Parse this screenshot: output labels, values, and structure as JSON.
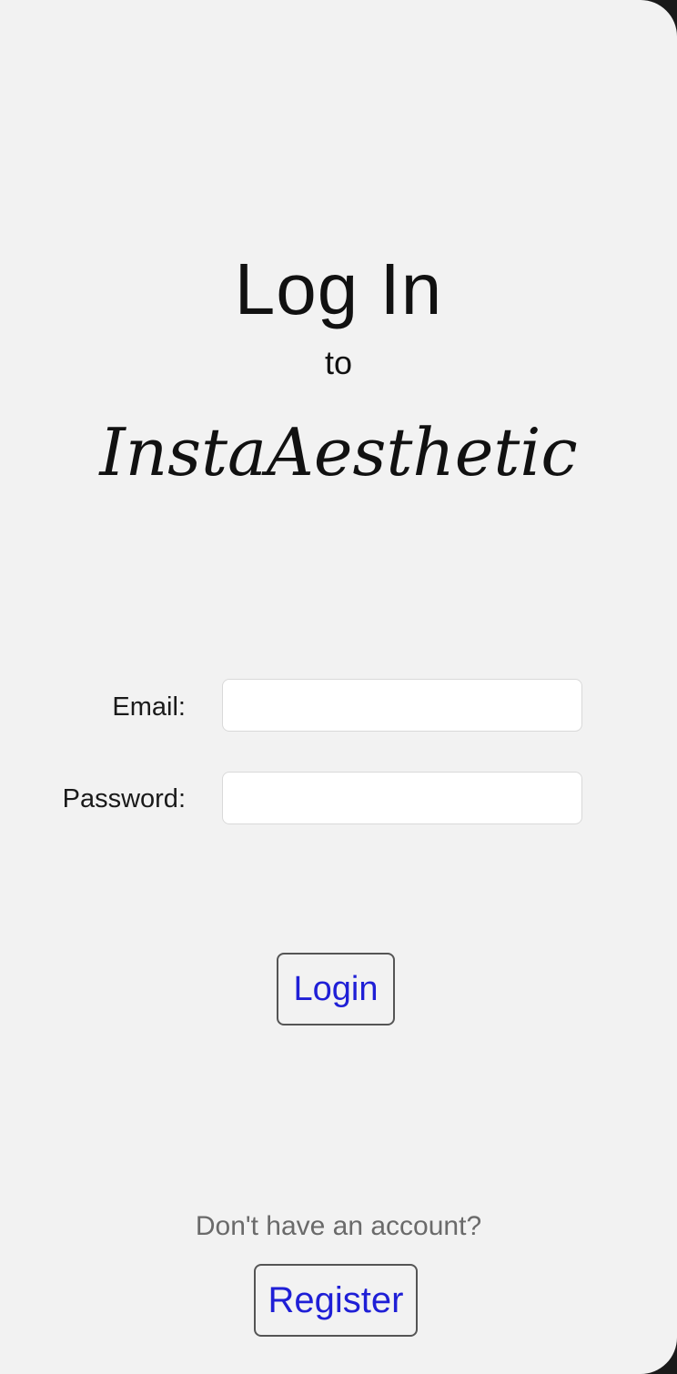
{
  "header": {
    "title": "Log In",
    "connector": "to",
    "app_name": "InstaAesthetic"
  },
  "form": {
    "email_label": "Email:",
    "email_value": "",
    "password_label": "Password:",
    "password_value": "",
    "login_label": "Login"
  },
  "footer": {
    "prompt": "Don't have an account?",
    "register_label": "Register"
  },
  "colors": {
    "background": "#f2f2f2",
    "link_blue": "#1f1fd6",
    "button_border": "#555555",
    "prompt_gray": "#6a6a6a"
  }
}
